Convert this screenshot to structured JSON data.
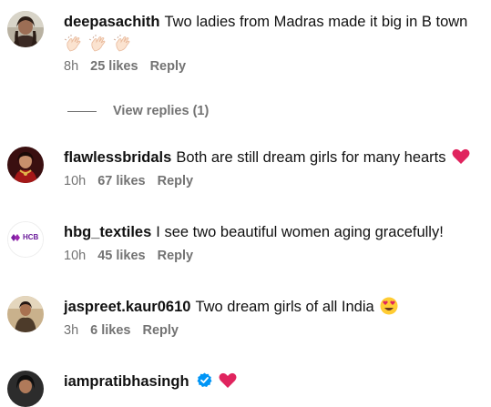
{
  "comments": [
    {
      "username": "deepasachith",
      "text": "Two ladies from Madras made it big in B town",
      "emoji": [
        "clapping-hands-icon",
        "clapping-hands-icon",
        "clapping-hands-icon"
      ],
      "time": "8h",
      "likes": "25 likes",
      "reply": "Reply",
      "view_replies": "View replies (1)"
    },
    {
      "username": "flawlessbridals",
      "text": "Both are still dream girls for many hearts",
      "emoji": [
        "red-heart-icon"
      ],
      "time": "10h",
      "likes": "67 likes",
      "reply": "Reply"
    },
    {
      "username": "hbg_textiles",
      "text": "I see two beautiful women aging gracefully!",
      "avatar_text": "HCB",
      "time": "10h",
      "likes": "45 likes",
      "reply": "Reply"
    },
    {
      "username": "jaspreet.kaur0610",
      "text": "Two dream girls of all India",
      "emoji": [
        "heart-eyes-face-icon"
      ],
      "time": "3h",
      "likes": "6 likes",
      "reply": "Reply"
    },
    {
      "username": "iampratibhasingh",
      "text": "",
      "emoji": [
        "verified-badge-icon",
        "red-heart-icon"
      ]
    }
  ],
  "colors": {
    "meta": "#737373",
    "heart": "#e0245e",
    "verified": "#0095f6",
    "avatar_purple": "#6a1b9a"
  }
}
